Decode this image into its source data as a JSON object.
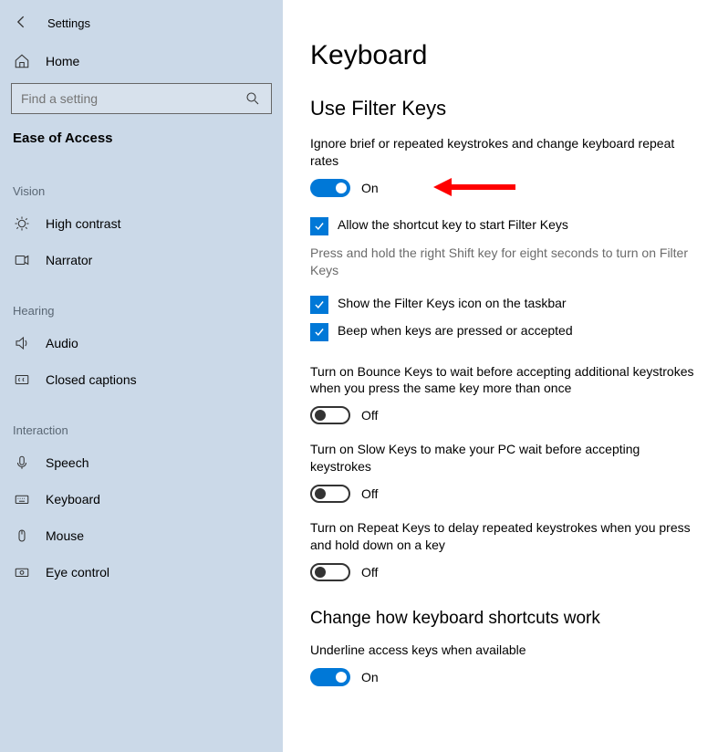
{
  "titlebar": {
    "app_name": "Settings"
  },
  "sidebar": {
    "home": "Home",
    "search_placeholder": "Find a setting",
    "section": "Ease of Access",
    "groups": {
      "vision": {
        "label": "Vision",
        "items": {
          "high_contrast": "High contrast",
          "narrator": "Narrator"
        }
      },
      "hearing": {
        "label": "Hearing",
        "items": {
          "audio": "Audio",
          "closed_captions": "Closed captions"
        }
      },
      "interaction": {
        "label": "Interaction",
        "items": {
          "speech": "Speech",
          "keyboard": "Keyboard",
          "mouse": "Mouse",
          "eye_control": "Eye control"
        }
      }
    }
  },
  "main": {
    "page_title": "Keyboard",
    "filter": {
      "heading": "Use Filter Keys",
      "desc": "Ignore brief or repeated keystrokes and change keyboard repeat rates",
      "toggle_state": "On",
      "allow_shortcut": "Allow the shortcut key to start Filter Keys",
      "allow_shortcut_sub": "Press and hold the right Shift key for eight seconds to turn on Filter Keys",
      "show_taskbar": "Show the Filter Keys icon on the taskbar",
      "beep": "Beep when keys are pressed or accepted",
      "bounce_desc": "Turn on Bounce Keys to wait before accepting additional keystrokes when you press the same key more than once",
      "bounce_state": "Off",
      "slow_desc": "Turn on Slow Keys to make your PC wait before accepting keystrokes",
      "slow_state": "Off",
      "repeat_desc": "Turn on Repeat Keys to delay repeated keystrokes when you press and hold down on a key",
      "repeat_state": "Off"
    },
    "shortcuts": {
      "heading": "Change how keyboard shortcuts work",
      "underline_desc": "Underline access keys when available",
      "underline_state": "On"
    }
  }
}
